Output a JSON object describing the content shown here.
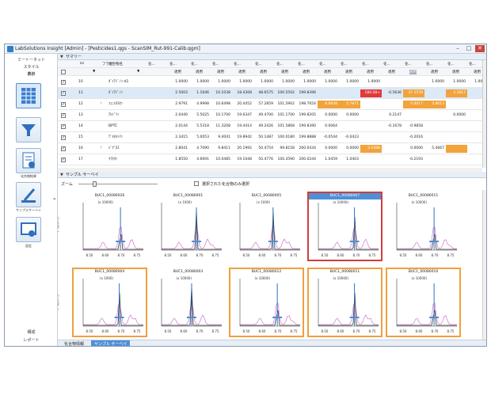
{
  "window": {
    "title": "LabSolutions Insight [Admin] - [Pesticides1.qgs - ScanSIM_Rut-991-Calib.qgm]",
    "buttons": [
      "–",
      "□",
      "✕"
    ]
  },
  "sidebar": {
    "links": [
      "ミートーネット",
      "スタイル",
      "表示"
    ],
    "buttons": [
      {
        "name": "grid",
        "caption": "",
        "icon": "grid-icon"
      },
      {
        "name": "filter",
        "caption": "",
        "icon": "filter-icon"
      },
      {
        "name": "report",
        "caption": "化合物結果",
        "icon": "report-icon"
      },
      {
        "name": "survey",
        "caption": "サンプルサーベイ",
        "icon": "microscope-icon"
      },
      {
        "name": "settings",
        "caption": "設定",
        "icon": "settings-icon"
      }
    ],
    "bottom_links": [
      "構成",
      "レポート"
    ],
    "collapse": "«"
  },
  "summary": {
    "title": "サマリー",
    "headers": [
      "",
      "",
      "ID",
      "",
      "フラグ",
      "化合物名",
      "化...",
      "化...",
      "化...",
      "化...",
      "化...",
      "化...",
      "化...",
      "化...",
      "化...",
      "化...",
      "化...",
      "化...",
      "化...",
      "化...",
      "化...",
      "化..."
    ],
    "subheaders": [
      "適用",
      "適用",
      "適用",
      "適用",
      "適用",
      "適用",
      "適用",
      "適用",
      "適用",
      "適用",
      "適用",
      "適用",
      "適用",
      "適用",
      "適用"
    ],
    "filter_row": [
      "▼",
      "▼"
    ],
    "rows": [
      {
        "id": "10",
        "flag": "",
        "name": "ﾀﾞｲｱｼﾞﾉﾝ-d1",
        "cells": [
          "1.0000",
          "1.0000",
          "1.0000",
          "1.0000",
          "1.0000",
          "1.0000",
          "1.0000",
          "1.0000",
          "1.0000",
          "1.0000",
          "",
          "",
          "1.0000",
          "1.0000",
          "1.0000"
        ]
      },
      {
        "id": "11",
        "flag": "",
        "name": "ﾀﾞｲｱｼﾞﾉﾝ",
        "cells": [
          "2.5003",
          "1.1646",
          "10.1038",
          "18.4308",
          "48.6575",
          "100.5502",
          "199.8396",
          "",
          "",
          "180.08+",
          "-0.5636",
          "37.3578",
          "",
          "4.3817",
          ""
        ]
      },
      {
        "id": "12",
        "flag": "!",
        "name": "ﾌｪﾆﾄﾛﾁｵﾝ",
        "cells": [
          "2.9791",
          "4.9998",
          "10.6498",
          "20.4452",
          "57.2859",
          "101.5902",
          "198.7654",
          "8.8928",
          "5.7871",
          "",
          "",
          "5.0017",
          "3.8013",
          "",
          ""
        ]
      },
      {
        "id": "13",
        "flag": "",
        "name": "ｱﾙﾄﾞﾘﾝ",
        "cells": [
          "2.0440",
          "5.5025",
          "10.1700",
          "19.6347",
          "49.4700",
          "101.1700",
          "199.8205",
          "0.0000",
          "0.0000",
          "",
          "0.2147",
          "",
          "",
          "0.0000",
          ""
        ]
      },
      {
        "id": "14",
        "flag": "",
        "name": "BPTC",
        "cells": [
          "2.0144",
          "5.5318",
          "11.3208",
          "19.4414",
          "49.2426",
          "101.5868",
          "199.8390",
          "0.0064",
          "",
          "",
          "-0.1678",
          "-0.9858",
          "",
          "",
          ""
        ]
      },
      {
        "id": "15",
        "flag": "",
        "name": "ﾃﾞﾙﾀﾒﾄﾘﾝ",
        "cells": [
          "2.3415",
          "5.0053",
          "9.4041",
          "19.8942",
          "50.1487",
          "100.0180",
          "199.8888",
          "-0.0544",
          "-0.0423",
          "",
          "",
          "-0.2016",
          "",
          "",
          ""
        ]
      },
      {
        "id": "16",
        "flag": "!",
        "name": "ﾊﾞｸﾞﾛｽ",
        "cells": [
          "2.8041",
          "4.7090",
          "9.8411",
          "20.1992",
          "50.4754",
          "99.8158",
          "200.0434",
          "0.0000",
          "0.0000",
          "3.5488",
          "",
          "0.0000",
          "5.4667",
          "",
          ""
        ]
      },
      {
        "id": "17",
        "flag": "",
        "name": "ﾏﾗﾁｵﾝ",
        "cells": [
          "1.8550",
          "4.6691",
          "10.0485",
          "19.1048",
          "50.4776",
          "100.3590",
          "200.0244",
          "1.0459",
          "1.0403",
          "",
          "",
          "-0.2193",
          "",
          "",
          ""
        ]
      }
    ]
  },
  "survey": {
    "title": "サンプル サーベイ",
    "zoom_label": "ズーム",
    "select_label": "選択された化合物のみ選択",
    "row_labels": [
      "ﾃﾞﾙﾀﾒﾄﾘﾝ",
      "ﾃﾞﾙﾀﾒﾄﾘﾝ"
    ],
    "tiles": [
      {
        "title": "BUC1_00080026",
        "ymax": "(x 10000)",
        "state": "none"
      },
      {
        "title": "BUC1_00080001",
        "ymax": "(x 1000)",
        "state": "none"
      },
      {
        "title": "BUC1_00080005",
        "ymax": "(x 1000)",
        "state": "none"
      },
      {
        "title": "BUC1_00080007",
        "ymax": "(x 10000)",
        "state": "red"
      },
      {
        "title": "BUC1_00080011",
        "ymax": "(x 10000)",
        "state": "none"
      },
      {
        "title": "BUC1_00080004",
        "ymax": "(x 1000)",
        "state": "orange"
      },
      {
        "title": "BUC1_00080003",
        "ymax": "(x 10000)",
        "state": "none"
      },
      {
        "title": "BUC1_00080012",
        "ymax": "(x 10000)",
        "state": "orange"
      },
      {
        "title": "BUC1_00080011",
        "ymax": "(x 10000)",
        "state": "orange"
      },
      {
        "title": "BUC1_00080010",
        "ymax": "(x 10000)",
        "state": "orange"
      }
    ],
    "xticks": [
      "8.50",
      "8.60",
      "8.70",
      "8.75"
    ]
  },
  "bottom_tabs": [
    "化合物情報",
    "サンプル サーベイ"
  ],
  "colors": {
    "red_cell": "#e03b3b",
    "orange_cell": "#f2a33a",
    "accent": "#4f8fd6",
    "trace_main": "#333333",
    "trace_ref": "#c860c8"
  }
}
